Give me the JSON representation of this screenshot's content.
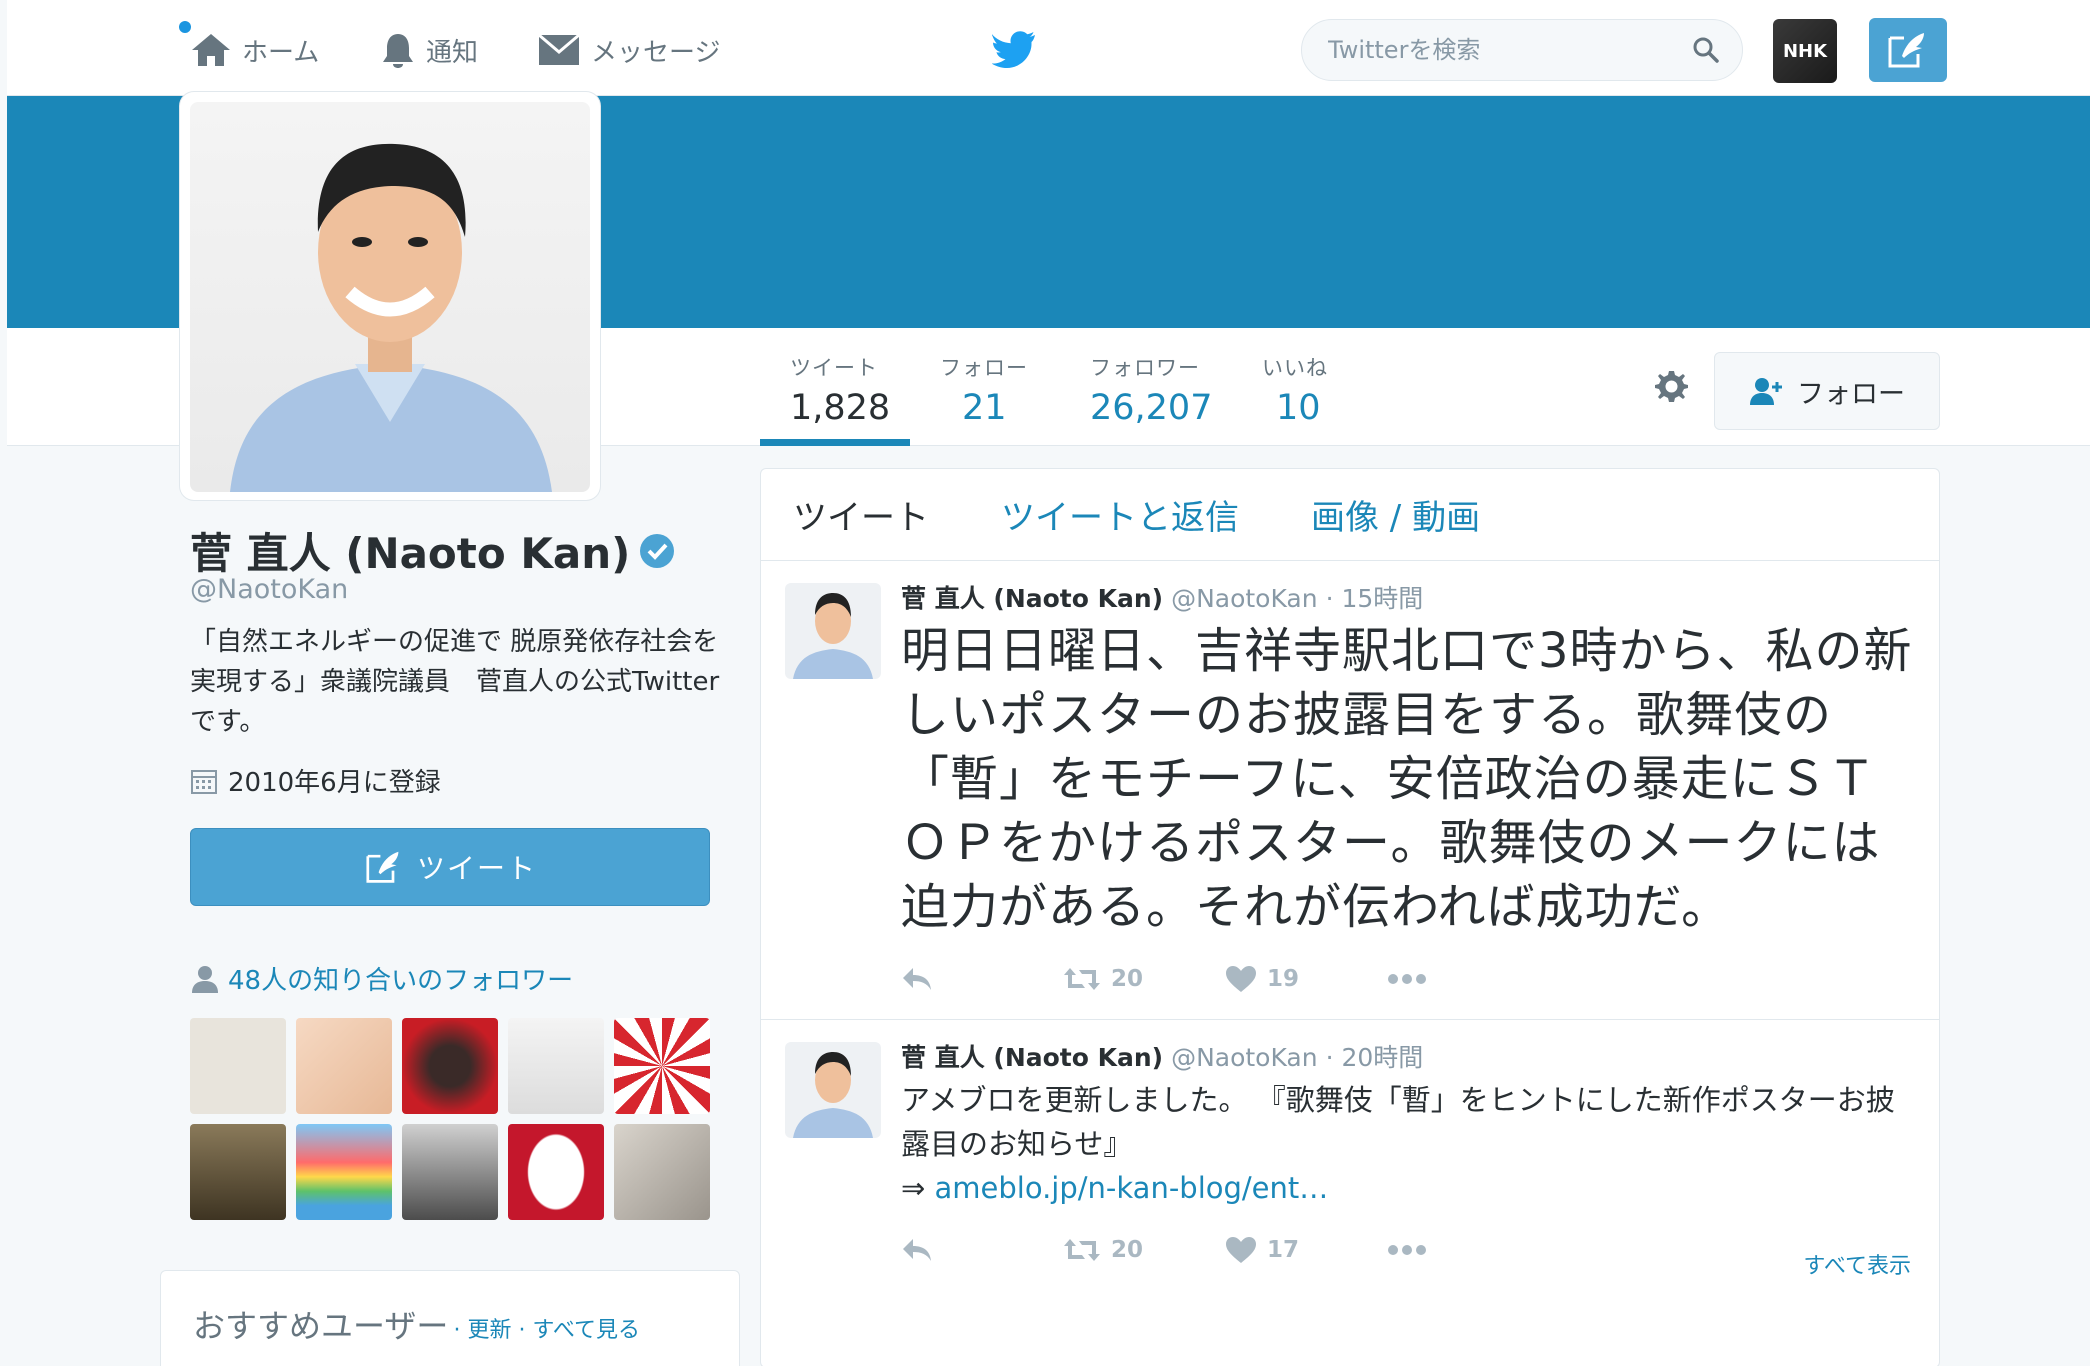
{
  "nav": {
    "home": "ホーム",
    "notifications": "通知",
    "messages": "メッセージ",
    "search_placeholder": "Twitterを検索",
    "user_avatar_text": "NHK"
  },
  "profile": {
    "name": "菅 直人 (Naoto Kan)",
    "handle": "@NaotoKan",
    "bio": "「自然エネルギーの促進で 脱原発依存社会を実現する」衆議院議員　菅直人の公式Twitterです。",
    "joined": "2010年6月に登録",
    "tweet_button": "ツイート",
    "known_followers": "48人の知り合いのフォロワー"
  },
  "stats": [
    {
      "label": "ツイート",
      "value": "1,828"
    },
    {
      "label": "フォロー",
      "value": "21"
    },
    {
      "label": "フォロワー",
      "value": "26,207"
    },
    {
      "label": "いいね",
      "value": "10"
    }
  ],
  "follow_button": "フォロー",
  "tabs": [
    "ツイート",
    "ツイートと返信",
    "画像 / 動画"
  ],
  "tweets": [
    {
      "name": "菅 直人 (Naoto Kan)",
      "handle": "@NaotoKan",
      "time": "· 15時間",
      "text": "明日日曜日、吉祥寺駅北口で3時から、私の新しいポスターのお披露目をする。歌舞伎の「暫」をモチーフに、安倍政治の暴走にＳＴＯＰをかけるポスター。歌舞伎のメークには迫力がある。それが伝われば成功だ。",
      "retweets": "20",
      "likes": "19"
    },
    {
      "name": "菅 直人 (Naoto Kan)",
      "handle": "@NaotoKan",
      "time": "· 20時間",
      "text": "アメブロを更新しました。 『歌舞伎「暫」をヒントにした新作ポスターお披露目のお知らせ』",
      "link_prefix": "⇒ ",
      "link": "ameblo.jp/n-kan-blog/ent…",
      "retweets": "20",
      "likes": "17",
      "show_all": "すべて表示"
    }
  ],
  "recommended": {
    "title": "おすすめユーザー",
    "links": "· 更新 · すべて見る"
  },
  "colors": {
    "accent": "#1b87b8",
    "button": "#4ba3d3",
    "banner": "#1b87b8"
  }
}
